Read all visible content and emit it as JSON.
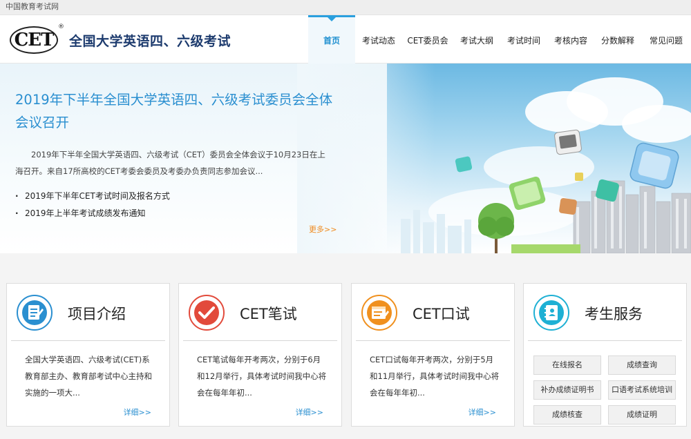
{
  "top_bar": {
    "site_name": "中国教育考试网"
  },
  "header": {
    "logo_text": "CET",
    "logo_reg": "®",
    "title": "全国大学英语四、六级考试"
  },
  "nav": {
    "items": [
      {
        "label": "首页",
        "active": true
      },
      {
        "label": "考试动态"
      },
      {
        "label": "CET委员会"
      },
      {
        "label": "考试大纲"
      },
      {
        "label": "考试时间"
      },
      {
        "label": "考核内容"
      },
      {
        "label": "分数解释"
      },
      {
        "label": "常见问题"
      }
    ]
  },
  "banner": {
    "headline": "2019年下半年全国大学英语四、六级考试委员会全体会议召开",
    "summary": "2019年下半年全国大学英语四、六级考试（CET）委员会全体会议于10月23日在上海召开。来自17所高校的CET考委会委员及考委办负责同志参加会议...",
    "news": [
      "2019年下半年CET考试时间及报名方式",
      "2019年上半年考试成绩发布通知"
    ],
    "more": "更多>>"
  },
  "cards": [
    {
      "title": "项目介绍",
      "desc": "全国大学英语四、六级考试(CET)系教育部主办、教育部考试中心主持和实施的一项大...",
      "more": "详细>>",
      "color": "#2a8fd0"
    },
    {
      "title": "CET笔试",
      "desc": "CET笔试每年开考两次，分别于6月和12月举行，具体考试时间我中心将会在每年年初...",
      "more": "详细>>",
      "color": "#e24a3b"
    },
    {
      "title": "CET口试",
      "desc": "CET口试每年开考两次，分别于5月和11月举行，具体考试时间我中心将会在每年年初...",
      "more": "详细>>",
      "color": "#f0901e"
    },
    {
      "title": "考生服务",
      "color": "#1eb0d4",
      "services": [
        "在线报名",
        "成绩查询",
        "补办成绩证明书",
        "口语考试系统培训",
        "成绩核查",
        "成绩证明"
      ]
    }
  ]
}
